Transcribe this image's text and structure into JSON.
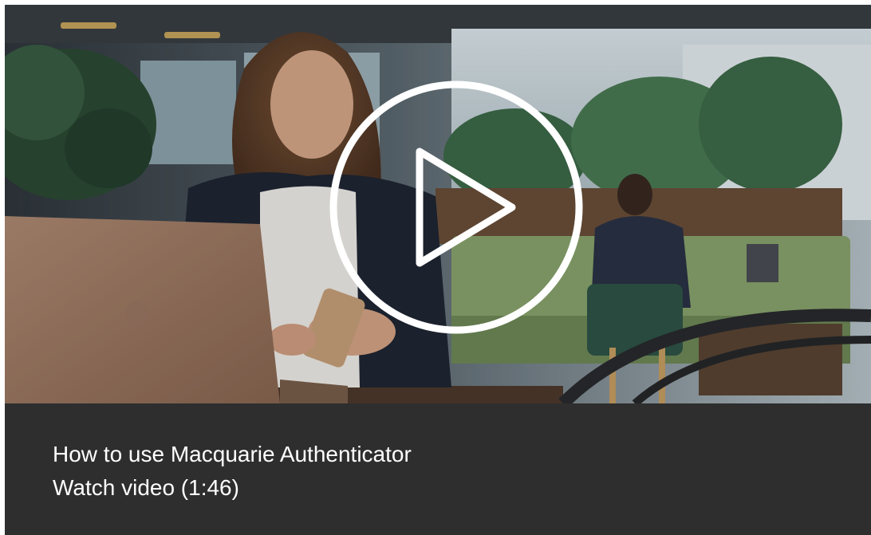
{
  "video": {
    "thumbnail_alt": "video-thumbnail",
    "play_icon": "play-circle-icon",
    "title": "How to use Macquarie Authenticator",
    "watch_label": "Watch video (1:46)"
  },
  "colors": {
    "caption_background": "#2e2e2e",
    "caption_text": "#ffffff",
    "play_icon": "#ffffff"
  }
}
